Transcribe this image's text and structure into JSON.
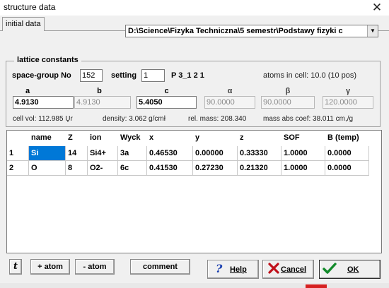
{
  "window": {
    "title": "structure data",
    "close_glyph": "✕"
  },
  "tabs": [
    {
      "label": "initial data"
    }
  ],
  "path": {
    "value": "D:\\Science\\Fizyka Techniczna\\5 semestr\\Podstawy fizyki c",
    "arrow": "▼"
  },
  "lattice": {
    "group_title": "lattice constants",
    "space_group_label": "space-group No",
    "space_group_value": "152",
    "setting_label": "setting",
    "setting_value": "1",
    "symbol": "P 3_1 2 1",
    "atoms_in_cell": "atoms in cell: 10.0   (10 pos)",
    "params": [
      {
        "head": "a",
        "value": "4.9130",
        "enabled": true
      },
      {
        "head": "b",
        "value": "4.9130",
        "enabled": false
      },
      {
        "head": "c",
        "value": "5.4050",
        "enabled": true
      },
      {
        "head": "α",
        "value": "90.0000",
        "enabled": false
      },
      {
        "head": "β",
        "value": "90.0000",
        "enabled": false
      },
      {
        "head": "γ",
        "value": "120.0000",
        "enabled": false
      }
    ],
    "cell_vol": "cell vol: 112.985 Ųr",
    "density": "density: 3.062 g/cmł",
    "rel_mass": "rel. mass: 208.340",
    "mass_abs": "mass abs coef: 38.011 cm,/g"
  },
  "table": {
    "columns": [
      "name",
      "Z",
      "ion",
      "Wyck",
      "x",
      "y",
      "z",
      "SOF",
      "B (temp)"
    ],
    "rows": [
      {
        "num": "1",
        "cells": [
          "Si",
          "14",
          "Si4+",
          "3a",
          "0.46530",
          "0.00000",
          "0.33330",
          "1.0000",
          "0.0000"
        ]
      },
      {
        "num": "2",
        "cells": [
          "O",
          "8",
          "O2-",
          "6c",
          "0.41530",
          "0.27230",
          "0.21320",
          "1.0000",
          "0.0000"
        ]
      }
    ]
  },
  "buttons": {
    "tool_glyph": "t",
    "add_atom": "+ atom",
    "remove_atom": "- atom",
    "comment": "comment",
    "help": "Help",
    "cancel": "Cancel",
    "ok": "OK"
  },
  "colors": {
    "selection": "#0078d7",
    "help_icon": "#1a3fb0",
    "cancel_icon": "#c0101a",
    "ok_icon": "#128a2a"
  }
}
